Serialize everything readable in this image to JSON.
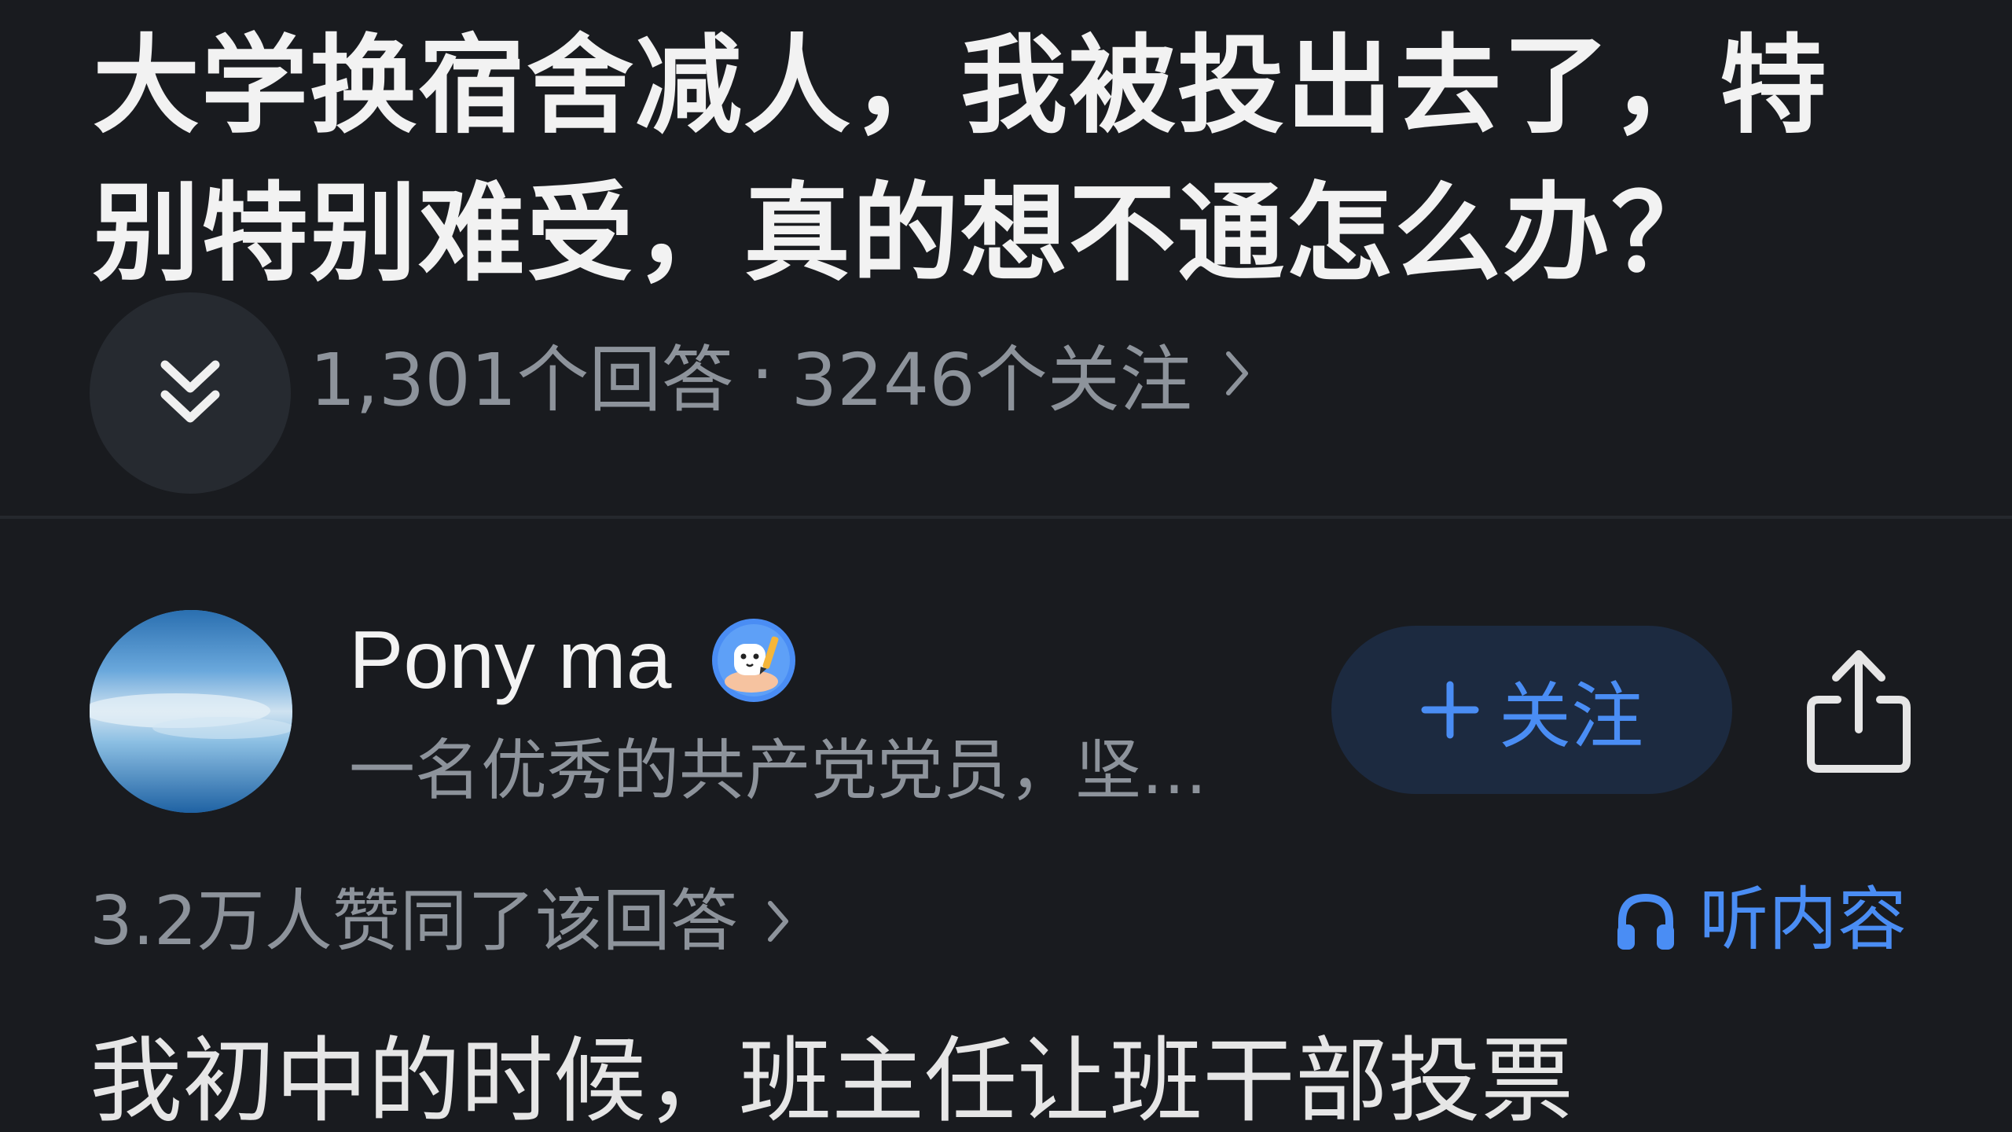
{
  "question": {
    "title": "大学换宿舍减人，我被投出去了，特别特别难受，真的想不通怎么办？",
    "answer_count": "1,301个回答",
    "separator": "·",
    "follower_count": "3246个关注"
  },
  "answer": {
    "author": {
      "name": "Pony ma",
      "bio": "一名优秀的共产党党员，坚…",
      "badge_icon": "writer-badge-icon"
    },
    "follow_label": "关注",
    "likes_text": "3.2万人赞同了该回答",
    "listen_label": "听内容",
    "content_first_line": "我初中的时候，班主任让班干部投票"
  },
  "colors": {
    "background": "#191b1f",
    "title_text": "#f2f2f2",
    "meta_text": "#8d939b",
    "accent_blue": "#4a8df4",
    "follow_button_bg": "#1c2a40",
    "collapse_button_bg": "#262a30"
  }
}
